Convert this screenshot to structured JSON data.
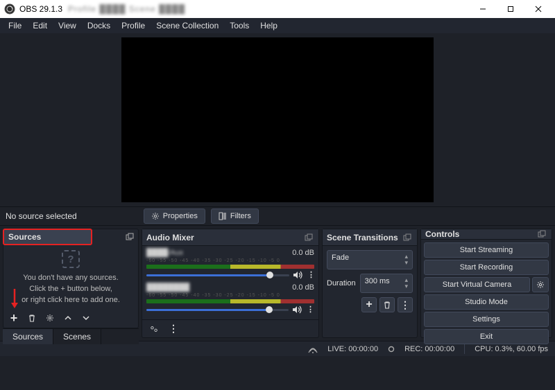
{
  "titlebar": {
    "app": "OBS 29.1.3",
    "blur_text": "Profile ████ Scene ████"
  },
  "menubar": [
    "File",
    "Edit",
    "View",
    "Docks",
    "Profile",
    "Scene Collection",
    "Tools",
    "Help"
  ],
  "infobar": {
    "no_source": "No source selected",
    "properties": "Properties",
    "filters": "Filters"
  },
  "sources": {
    "title": "Sources",
    "empty_line1": "You don't have any sources.",
    "empty_line2": "Click the + button below,",
    "empty_line3": "or right click here to add one."
  },
  "tabs": {
    "sources": "Sources",
    "scenes": "Scenes"
  },
  "mixer": {
    "title": "Audio Mixer",
    "rows": [
      {
        "name": "████/Aux",
        "db": "0.0 dB"
      },
      {
        "name": "████████",
        "db": "0.0 dB"
      }
    ],
    "ticks": "-60 -55 -50 -45 -40 -35 -30 -25 -20 -15 -10 -5 0"
  },
  "transitions": {
    "title": "Scene Transitions",
    "selected": "Fade",
    "duration_label": "Duration",
    "duration_value": "300 ms"
  },
  "controls": {
    "title": "Controls",
    "buttons": {
      "stream": "Start Streaming",
      "record": "Start Recording",
      "vcam": "Start Virtual Camera",
      "studio": "Studio Mode",
      "settings": "Settings",
      "exit": "Exit"
    }
  },
  "statusbar": {
    "live": "LIVE: 00:00:00",
    "rec": "REC: 00:00:00",
    "cpu": "CPU: 0.3%, 60.00 fps"
  }
}
